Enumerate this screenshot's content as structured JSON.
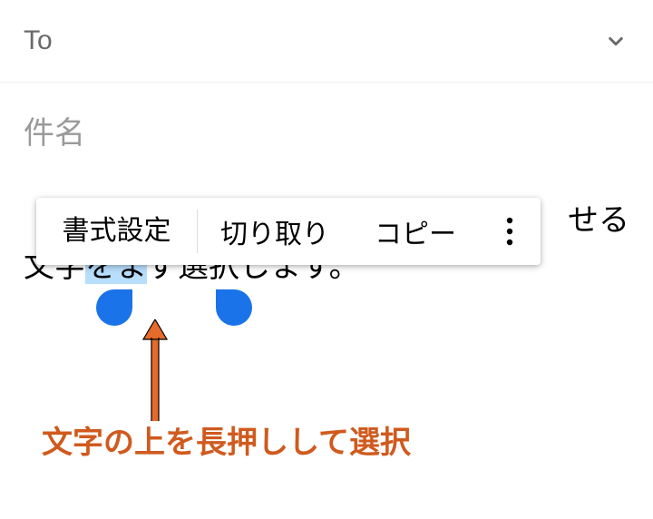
{
  "to": {
    "label": "To"
  },
  "subject": {
    "placeholder": "件名"
  },
  "body": {
    "line1_suffix": "せる",
    "line2_before": "文字",
    "line2_selected": "をま",
    "line2_after": "ず選択します。"
  },
  "context_menu": {
    "format": "書式設定",
    "cut": "切り取り",
    "copy": "コピー"
  },
  "annotation": {
    "caption": "文字の上を長押しして選択"
  },
  "colors": {
    "selection": "#b7defd",
    "handle": "#1a73e8",
    "annotation": "#d05a1e"
  }
}
